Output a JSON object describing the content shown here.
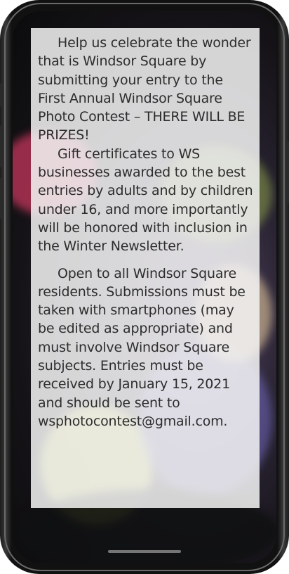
{
  "notice": {
    "paragraphs": [
      "Help us celebrate the wonder that is Windsor Square by submitting your entry to the First Annual Windsor Square Photo Contest – THERE WILL BE PRIZES!",
      "Gift certificates to WS businesses awarded to the best entries by adults and by children under 16, and more importantly will be honored with inclusion in the Winter Newsletter.",
      "Open to all Windsor Square residents. Submissions must be taken with smartphones (may be edited as appropriate) and must involve Windsor Square subjects. Entries must be received by January 15, 2021 and should be sent to wsphotocontest@gmail.com."
    ]
  },
  "colors": {
    "panel_background": "#f5f5f5",
    "text": "#2d2d2d",
    "phone_frame": "#111111"
  }
}
